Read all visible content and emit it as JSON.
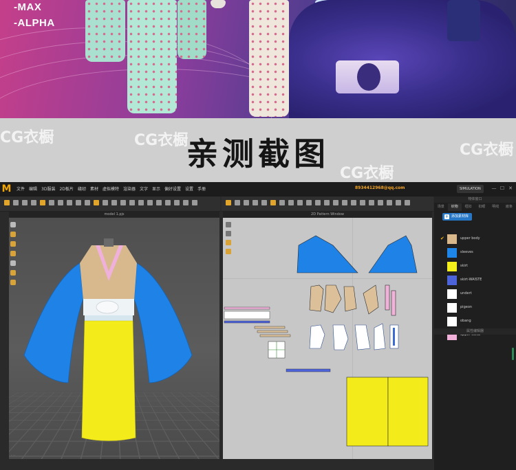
{
  "banner": {
    "tags": [
      "-MAX",
      "-ALPHA"
    ]
  },
  "title": "亲测截图",
  "watermarks": [
    "CG衣橱",
    "CG衣橱",
    "CG衣橱",
    "CG衣橱"
  ],
  "app": {
    "logo_char": "M",
    "menu": [
      "文件",
      "编辑",
      "3D服装",
      "2D板片",
      "缝纫",
      "素材",
      "虚拟模特",
      "渲染器",
      "文字",
      "显示",
      "偏好设置",
      "设置",
      "手册"
    ],
    "account": "8934412968@qq.com",
    "mode_badge": "SIMULATION",
    "window_buttons": [
      "—",
      "☐",
      "✕"
    ],
    "viewport3d_tab": "model 1.pjs",
    "viewport2d_tab": "2D Pattern Window",
    "panel": {
      "title": "物体窗口",
      "tabs": [
        "场景",
        "织物",
        "纽扣",
        "扣眼",
        "明线",
        "嵌条"
      ],
      "active_tab": "织物",
      "add_button": "添加素材库",
      "fabrics": [
        {
          "name": "upper body",
          "color": "#d9b98c",
          "checked": true
        },
        {
          "name": "sleeves",
          "color": "#1e86e8",
          "checked": false
        },
        {
          "name": "skirt",
          "color": "#f4f01c",
          "checked": false
        },
        {
          "name": "skirt-WAISTE",
          "color": "#4d63d9",
          "checked": false
        },
        {
          "name": "undert",
          "color": "#ffffff",
          "checked": false
        },
        {
          "name": "pigeon",
          "color": "#ffffff",
          "checked": false
        },
        {
          "name": "obang",
          "color": "#ffffff",
          "checked": false
        },
        {
          "name": "upper collar",
          "color": "#f0b0d8",
          "checked": false
        }
      ],
      "footer": "属性编辑器"
    }
  }
}
